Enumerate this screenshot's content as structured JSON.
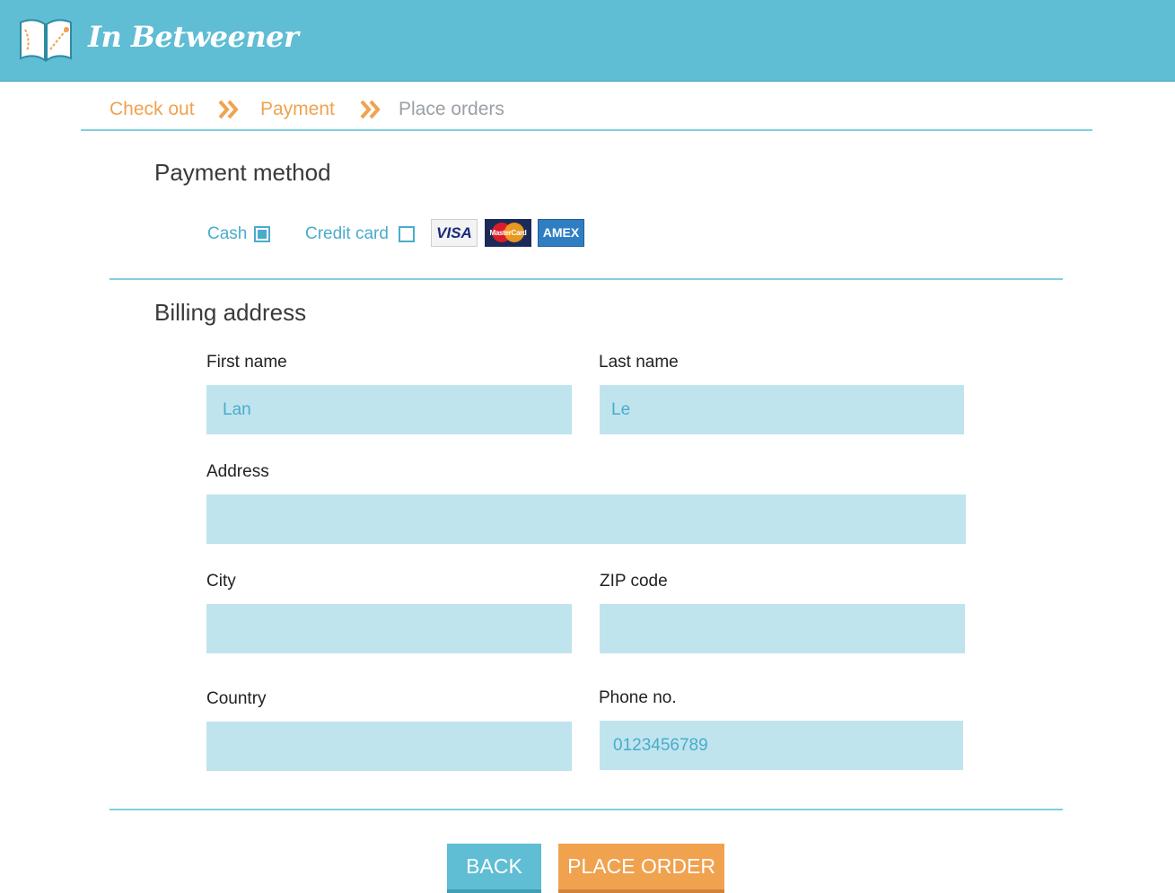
{
  "app": {
    "brand": "In Betweener"
  },
  "breadcrumb": {
    "steps": [
      {
        "label": "Check out",
        "state": "done"
      },
      {
        "label": "Payment",
        "state": "done"
      },
      {
        "label": "Place orders",
        "state": "todo"
      }
    ],
    "separator_icon": "double-chevron-right-icon"
  },
  "payment": {
    "title": "Payment method",
    "options": [
      {
        "label": "Cash",
        "checked": true
      },
      {
        "label": "Credit card",
        "checked": false
      }
    ],
    "cards": [
      "VISA",
      "MasterCard",
      "AMEX"
    ]
  },
  "billing": {
    "title": "Billing address",
    "fields": {
      "first_name": {
        "label": "First name",
        "value": "Lan"
      },
      "last_name": {
        "label": "Last name",
        "value": "Le"
      },
      "address": {
        "label": "Address",
        "value": ""
      },
      "city": {
        "label": "City",
        "value": ""
      },
      "zip": {
        "label": "ZIP code",
        "value": ""
      },
      "country": {
        "label": "Country",
        "value": ""
      },
      "phone": {
        "label": "Phone no.",
        "value": "0123456789"
      }
    }
  },
  "actions": {
    "back": "BACK",
    "place_order": "PLACE ORDER"
  },
  "colors": {
    "header": "#5fbdd4",
    "accent_orange": "#f0a24f",
    "accent_blue": "#4aaccb",
    "input_bg": "#bfe4ee"
  }
}
